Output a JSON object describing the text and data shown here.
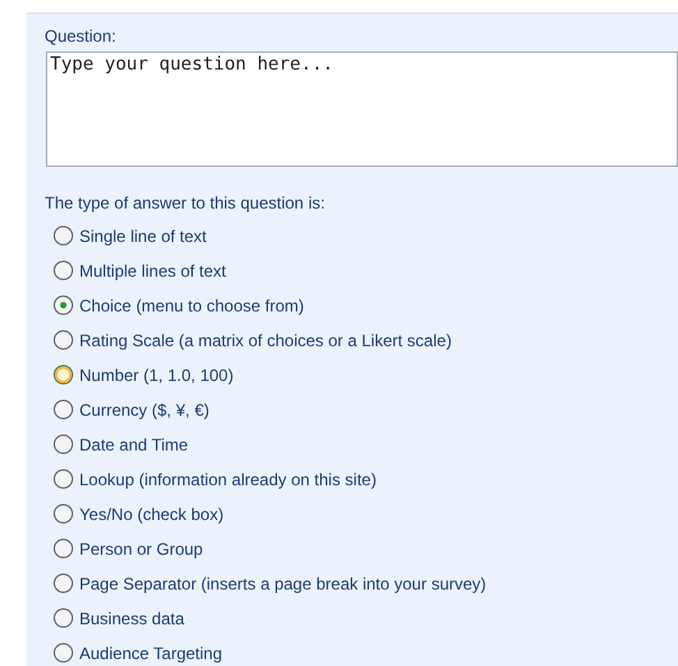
{
  "question": {
    "label": "Question:",
    "value": "Type your question here..."
  },
  "answer_type": {
    "label": "The type of answer to this question is:",
    "options": [
      {
        "label": "Single line of text",
        "selected": false,
        "hovered": false
      },
      {
        "label": "Multiple lines of text",
        "selected": false,
        "hovered": false
      },
      {
        "label": "Choice (menu to choose from)",
        "selected": true,
        "hovered": false
      },
      {
        "label": "Rating Scale (a matrix of choices or a Likert scale)",
        "selected": false,
        "hovered": false
      },
      {
        "label": "Number (1, 1.0, 100)",
        "selected": false,
        "hovered": true
      },
      {
        "label": "Currency ($, ¥, €)",
        "selected": false,
        "hovered": false
      },
      {
        "label": "Date and Time",
        "selected": false,
        "hovered": false
      },
      {
        "label": "Lookup (information already on this site)",
        "selected": false,
        "hovered": false
      },
      {
        "label": "Yes/No (check box)",
        "selected": false,
        "hovered": false
      },
      {
        "label": "Person or Group",
        "selected": false,
        "hovered": false
      },
      {
        "label": "Page Separator (inserts a page break into your survey)",
        "selected": false,
        "hovered": false
      },
      {
        "label": "Business data",
        "selected": false,
        "hovered": false
      },
      {
        "label": "Audience Targeting",
        "selected": false,
        "hovered": false
      }
    ]
  }
}
